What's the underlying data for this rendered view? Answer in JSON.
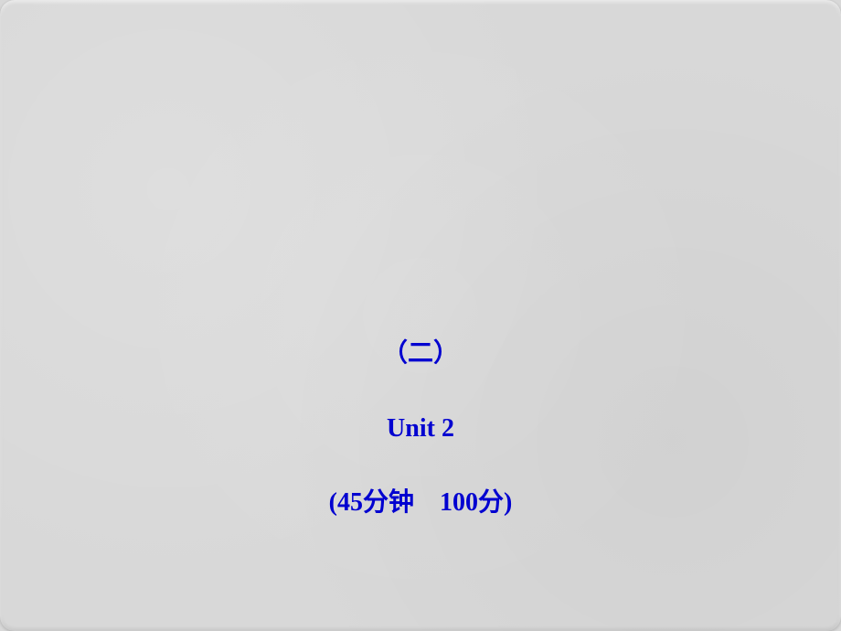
{
  "slide": {
    "section_label": "（二）",
    "unit_label": "Unit 2",
    "duration_score": "(45分钟　100分)"
  },
  "colors": {
    "text": "#0000d0",
    "background": "#d8d8d8"
  }
}
